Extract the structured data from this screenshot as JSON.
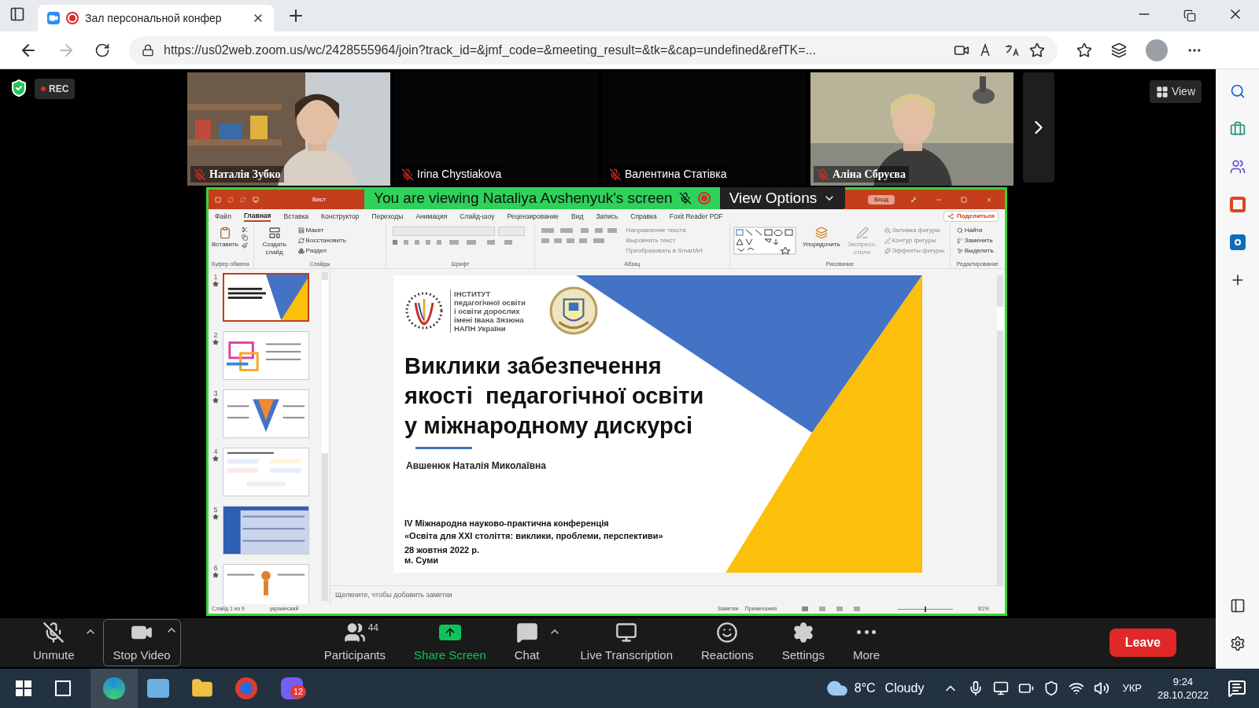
{
  "browser": {
    "tab_title": "Зал персональной конфер",
    "url": "https://us02web.zoom.us/wc/2428555964/join?track_id=&jmf_code=&meeting_result=&tk=&cap=undefined&refTK=..."
  },
  "meeting": {
    "rec_label": "REC",
    "view_button": "View",
    "tiles": [
      {
        "name": "Наталія Зубко",
        "muted": true,
        "kind": "video"
      },
      {
        "name": "Irina Chystiakova",
        "muted": true,
        "kind": "blank"
      },
      {
        "name": "Валентина Статівка",
        "muted": true,
        "kind": "blank"
      },
      {
        "name": "Аліна Сбруєва",
        "muted": true,
        "kind": "video"
      }
    ],
    "share_banner": "You are viewing Nataliya Avshenyuk's screen",
    "view_options": "View Options"
  },
  "powerpoint": {
    "title_fragment": "Вист",
    "login_button": "Вход",
    "share_button": "Поделиться",
    "tabs": [
      {
        "label": "Файл",
        "selected": false
      },
      {
        "label": "Главная",
        "selected": true
      },
      {
        "label": "Вставка",
        "selected": false
      },
      {
        "label": "Конструктор",
        "selected": false
      },
      {
        "label": "Переходы",
        "selected": false
      },
      {
        "label": "Анимация",
        "selected": false
      },
      {
        "label": "Слайд-шоу",
        "selected": false
      },
      {
        "label": "Рецензирование",
        "selected": false
      },
      {
        "label": "Вид",
        "selected": false
      },
      {
        "label": "Запись",
        "selected": false
      },
      {
        "label": "Справка",
        "selected": false
      },
      {
        "label": "Foxit Reader PDF",
        "selected": false
      }
    ],
    "ribbon": {
      "paste": "Вставить",
      "clipboard_label": "Буфер обмена",
      "new_slide": "Создать слайд",
      "layout": "Макет",
      "reset": "Восстановить",
      "section": "Раздел",
      "slides_label": "Слайды",
      "font_label": "Шрифт",
      "text_direction": "Направление текста",
      "align_text": "Выровнять текст",
      "smartart": "Преобразовать в SmartArt",
      "paragraph_label": "Абзац",
      "arrange": "Упорядочить",
      "quick_styles": "Экспресс-стили",
      "shape_fill": "Заливка фигуры",
      "shape_outline": "Контур фигуры",
      "shape_effects": "Эффекты фигуры",
      "drawing_label": "Рисование",
      "find": "Найти",
      "replace": "Заменить",
      "select": "Выделить",
      "editing_label": "Редактирование"
    },
    "thumbnails": [
      {
        "number": "1",
        "selected": true
      },
      {
        "number": "2",
        "selected": false
      },
      {
        "number": "3",
        "selected": false
      },
      {
        "number": "4",
        "selected": false
      },
      {
        "number": "5",
        "selected": false
      },
      {
        "number": "6",
        "selected": false
      }
    ],
    "slide": {
      "institute": [
        "ІНСТИТУТ",
        "педагогічної освіти",
        "і освіти дорослих",
        "імені Івана Зязюна",
        "НАПН України"
      ],
      "title": [
        "Виклики забезпечення",
        "якості  педагогічної освіти",
        "у міжнародному дискурсі"
      ],
      "author": "Авшенюк Наталія Миколаївна",
      "conference": [
        "IV Міжнародна науково-практична конференція",
        "«Освіта для XXI століття: виклики, проблеми, перспективи»"
      ],
      "date": "28 жовтня 2022 р.",
      "city": "м. Суми"
    },
    "notes_placeholder": "Щелкните, чтобы добавить заметки",
    "status": {
      "slide_counter": "Слайд 1 из 9",
      "language": "украинский",
      "notes": "Заметки",
      "comments": "Примечания",
      "zoom": "81%",
      "zoom_slider": {
        "level": 0.5
      }
    }
  },
  "toolbar": {
    "items": [
      {
        "kind": "unmute",
        "label": "Unmute"
      },
      {
        "kind": "video",
        "label": "Stop Video"
      },
      {
        "kind": "participants",
        "label": "Participants",
        "count": "44"
      },
      {
        "kind": "share",
        "label": "Share Screen"
      },
      {
        "kind": "chat",
        "label": "Chat"
      },
      {
        "kind": "cc",
        "label": "Live Transcription"
      },
      {
        "kind": "reactions",
        "label": "Reactions"
      },
      {
        "kind": "settings",
        "label": "Settings"
      },
      {
        "kind": "more",
        "label": "More"
      }
    ],
    "leave": "Leave"
  },
  "taskbar": {
    "viber_badge": "12",
    "temperature": "8°C",
    "weather": "Cloudy",
    "language": "УКР",
    "time": "9:24",
    "date": "28.10.2022"
  }
}
